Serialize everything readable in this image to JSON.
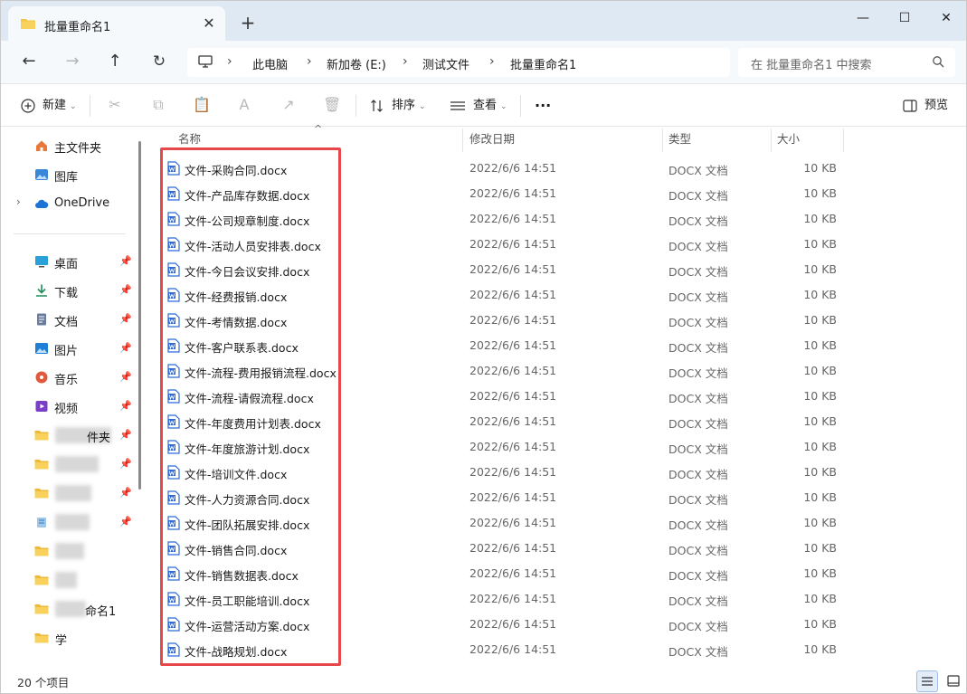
{
  "tab": {
    "title": "批量重命名1",
    "close_glyph": "✕",
    "new_glyph": "+"
  },
  "window": {
    "min_glyph": "—",
    "max_glyph": "☐",
    "close_glyph": "✕"
  },
  "nav": {
    "back_glyph": "←",
    "forward_glyph": "→",
    "up_glyph": "↑",
    "refresh_glyph": "↻"
  },
  "breadcrumb": [
    "此电脑",
    "新加卷 (E:)",
    "测试文件",
    "批量重命名1"
  ],
  "breadcrumb_separator": "›",
  "search": {
    "placeholder": "在 批量重命名1 中搜索"
  },
  "toolbar": {
    "new_label": "新建",
    "sort_label": "排序",
    "view_label": "查看",
    "more_label": "···",
    "preview_label": "预览",
    "caret": "⌄",
    "icons": {
      "cut": "✂",
      "copy": "⧉",
      "paste": "📋",
      "rename": "A",
      "share": "↗",
      "delete": "🗑"
    }
  },
  "sidebar": {
    "expand_glyph": "›",
    "pin_glyph": "📌",
    "top_items": [
      {
        "label": "主文件夹",
        "icon": "home-icon"
      },
      {
        "label": "图库",
        "icon": "gallery-icon"
      },
      {
        "label": "OneDrive",
        "icon": "cloud-icon"
      }
    ],
    "quick_access": [
      {
        "label": "桌面",
        "icon": "desktop-icon",
        "pinned": true
      },
      {
        "label": "下载",
        "icon": "download-icon",
        "pinned": true
      },
      {
        "label": "文档",
        "icon": "document-icon",
        "pinned": true
      },
      {
        "label": "图片",
        "icon": "picture-icon",
        "pinned": true
      },
      {
        "label": "音乐",
        "icon": "music-icon",
        "pinned": true
      },
      {
        "label": "视频",
        "icon": "video-icon",
        "pinned": true
      },
      {
        "label": "件夹",
        "icon": "folder-icon",
        "pinned": true
      },
      {
        "label": "",
        "icon": "folder-icon",
        "pinned": true
      },
      {
        "label": "",
        "icon": "folder-icon",
        "pinned": true
      },
      {
        "label": "",
        "icon": "recycle-icon",
        "pinned": true
      },
      {
        "label": "",
        "icon": "folder-icon",
        "pinned": false
      },
      {
        "label": "",
        "icon": "folder-icon",
        "pinned": false
      },
      {
        "label": "命名1",
        "icon": "folder-icon",
        "pinned": false
      },
      {
        "label": "学",
        "icon": "folder-icon",
        "pinned": false
      }
    ]
  },
  "columns": {
    "name": "名称",
    "modified": "修改日期",
    "type": "类型",
    "size": "大小",
    "sort_glyph": "^"
  },
  "files": [
    {
      "name": "文件-采购合同.docx",
      "modified": "2022/6/6 14:51",
      "type": "DOCX 文档",
      "size": "10 KB"
    },
    {
      "name": "文件-产品库存数据.docx",
      "modified": "2022/6/6 14:51",
      "type": "DOCX 文档",
      "size": "10 KB"
    },
    {
      "name": "文件-公司规章制度.docx",
      "modified": "2022/6/6 14:51",
      "type": "DOCX 文档",
      "size": "10 KB"
    },
    {
      "name": "文件-活动人员安排表.docx",
      "modified": "2022/6/6 14:51",
      "type": "DOCX 文档",
      "size": "10 KB"
    },
    {
      "name": "文件-今日会议安排.docx",
      "modified": "2022/6/6 14:51",
      "type": "DOCX 文档",
      "size": "10 KB"
    },
    {
      "name": "文件-经费报销.docx",
      "modified": "2022/6/6 14:51",
      "type": "DOCX 文档",
      "size": "10 KB"
    },
    {
      "name": "文件-考情数据.docx",
      "modified": "2022/6/6 14:51",
      "type": "DOCX 文档",
      "size": "10 KB"
    },
    {
      "name": "文件-客户联系表.docx",
      "modified": "2022/6/6 14:51",
      "type": "DOCX 文档",
      "size": "10 KB"
    },
    {
      "name": "文件-流程-费用报销流程.docx",
      "modified": "2022/6/6 14:51",
      "type": "DOCX 文档",
      "size": "10 KB"
    },
    {
      "name": "文件-流程-请假流程.docx",
      "modified": "2022/6/6 14:51",
      "type": "DOCX 文档",
      "size": "10 KB"
    },
    {
      "name": "文件-年度费用计划表.docx",
      "modified": "2022/6/6 14:51",
      "type": "DOCX 文档",
      "size": "10 KB"
    },
    {
      "name": "文件-年度旅游计划.docx",
      "modified": "2022/6/6 14:51",
      "type": "DOCX 文档",
      "size": "10 KB"
    },
    {
      "name": "文件-培训文件.docx",
      "modified": "2022/6/6 14:51",
      "type": "DOCX 文档",
      "size": "10 KB"
    },
    {
      "name": "文件-人力资源合同.docx",
      "modified": "2022/6/6 14:51",
      "type": "DOCX 文档",
      "size": "10 KB"
    },
    {
      "name": "文件-团队拓展安排.docx",
      "modified": "2022/6/6 14:51",
      "type": "DOCX 文档",
      "size": "10 KB"
    },
    {
      "name": "文件-销售合同.docx",
      "modified": "2022/6/6 14:51",
      "type": "DOCX 文档",
      "size": "10 KB"
    },
    {
      "name": "文件-销售数据表.docx",
      "modified": "2022/6/6 14:51",
      "type": "DOCX 文档",
      "size": "10 KB"
    },
    {
      "name": "文件-员工职能培训.docx",
      "modified": "2022/6/6 14:51",
      "type": "DOCX 文档",
      "size": "10 KB"
    },
    {
      "name": "文件-运营活动方案.docx",
      "modified": "2022/6/6 14:51",
      "type": "DOCX 文档",
      "size": "10 KB"
    },
    {
      "name": "文件-战略规划.docx",
      "modified": "2022/6/6 14:51",
      "type": "DOCX 文档",
      "size": "10 KB"
    }
  ],
  "status": {
    "item_count": "20 个项目"
  },
  "colors": {
    "accent": "#2f6fd6",
    "highlight_box": "#e5474b",
    "titlebar": "#dfe9f4",
    "folder": "#f4c542",
    "word": "#2b6ad8"
  }
}
